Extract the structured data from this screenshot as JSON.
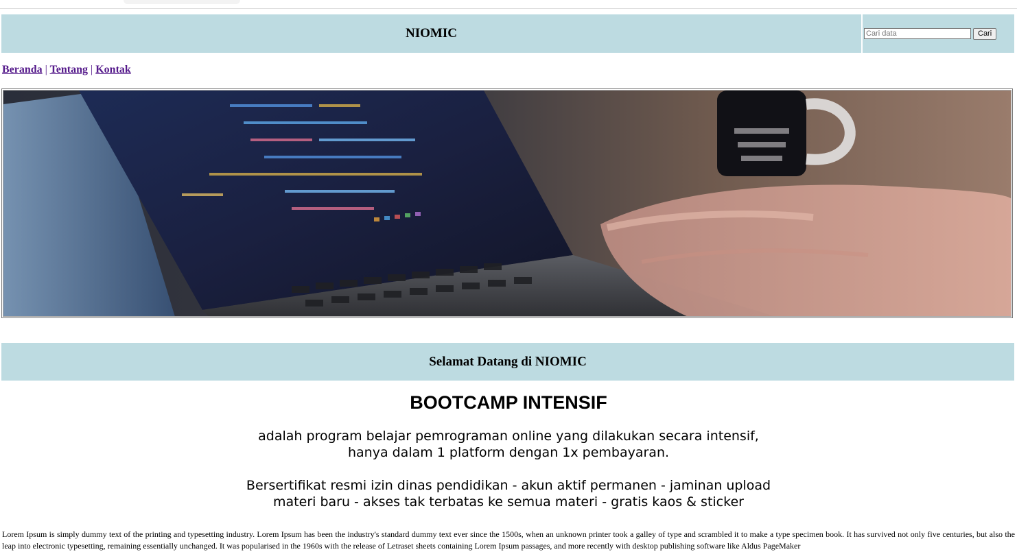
{
  "header": {
    "brand": "NIOMIC",
    "search_placeholder": "Cari data",
    "search_button": "Cari"
  },
  "nav": {
    "items": [
      "Beranda",
      "Tentang",
      "Kontak"
    ],
    "separator": "|"
  },
  "banner": {
    "icon": "laptop-coding-photo"
  },
  "welcome": "Selamat Datang di NIOMIC",
  "bootcamp": {
    "title": "BOOTCAMP INTENSIF",
    "line1": "adalah program belajar pemrograman online yang dilakukan secara intensif,",
    "line2": "hanya dalam 1 platform dengan 1x pembayaran.",
    "line3": "Bersertifikat resmi izin dinas pendidikan - akun aktif permanen - jaminan upload",
    "line4": "materi baru - akses tak terbatas ke semua materi - gratis kaos & sticker"
  },
  "lorem": "Lorem Ipsum is simply dummy text of the printing and typesetting industry. Lorem Ipsum has been the industry's standard dummy text ever since the 1500s, when an unknown printer took a galley of type and scrambled it to make a type specimen book. It has survived not only five centuries, but also the leap into electronic typesetting, remaining essentially unchanged. It was popularised in the 1960s with the release of Letraset sheets containing Lorem Ipsum passages, and more recently with desktop publishing software like Aldus PageMaker",
  "colors": {
    "header_bg": "#bddbe1",
    "link": "#551a8b"
  }
}
